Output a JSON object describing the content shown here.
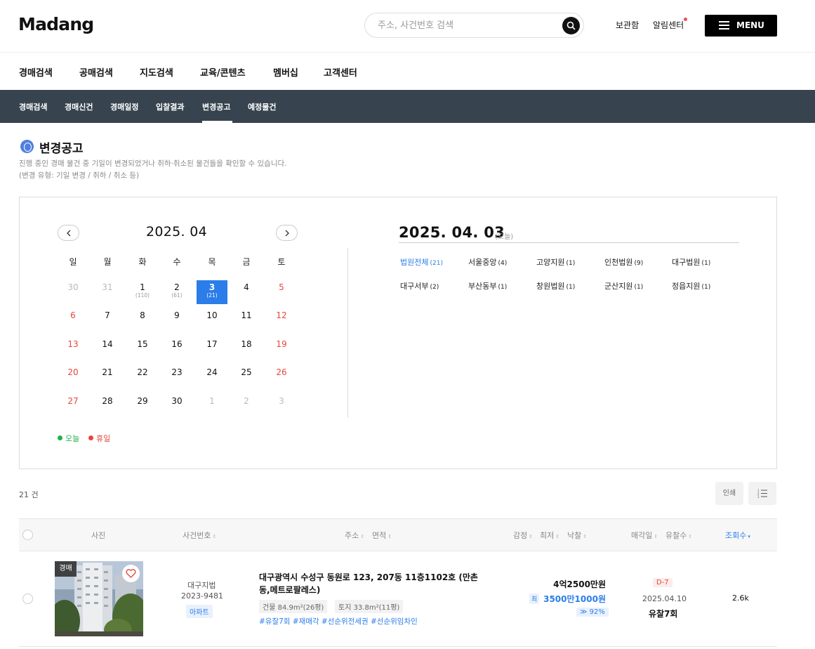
{
  "header": {
    "logo": "Madang",
    "search_placeholder": "주소, 사건번호 검색",
    "links": {
      "saved": "보관함",
      "alerts": "알림센터"
    },
    "menu_label": "MENU"
  },
  "main_nav": [
    "경매검색",
    "공매검색",
    "지도검색",
    "교육/콘텐츠",
    "멤버십",
    "고객센터"
  ],
  "sub_nav": {
    "items": [
      "경매검색",
      "경매신건",
      "경매일정",
      "입찰결과",
      "변경공고",
      "예정물건"
    ],
    "active": "변경공고"
  },
  "page": {
    "title": "변경공고",
    "desc_line1": "진행 중인 경매 물건 중 기일이 변경되었거나 취하·취소된 물건들을 확인할 수 있습니다.",
    "desc_line2": "(변경 유형: 기일 변경 / 취하 / 취소 등)"
  },
  "calendar": {
    "month_title": "2025. 04",
    "weekdays": [
      "일",
      "월",
      "화",
      "수",
      "목",
      "금",
      "토"
    ],
    "weeks": [
      [
        {
          "d": "30",
          "t": "gray"
        },
        {
          "d": "31",
          "t": "gray"
        },
        {
          "d": "1",
          "c": "(110)"
        },
        {
          "d": "2",
          "c": "(61)"
        },
        {
          "d": "3",
          "c": "(21)",
          "t": "sel"
        },
        {
          "d": "4"
        },
        {
          "d": "5",
          "t": "red"
        }
      ],
      [
        {
          "d": "6",
          "t": "red"
        },
        {
          "d": "7"
        },
        {
          "d": "8"
        },
        {
          "d": "9"
        },
        {
          "d": "10"
        },
        {
          "d": "11"
        },
        {
          "d": "12",
          "t": "red"
        }
      ],
      [
        {
          "d": "13",
          "t": "red"
        },
        {
          "d": "14"
        },
        {
          "d": "15"
        },
        {
          "d": "16"
        },
        {
          "d": "17"
        },
        {
          "d": "18"
        },
        {
          "d": "19",
          "t": "red"
        }
      ],
      [
        {
          "d": "20",
          "t": "red"
        },
        {
          "d": "21"
        },
        {
          "d": "22"
        },
        {
          "d": "23"
        },
        {
          "d": "24"
        },
        {
          "d": "25"
        },
        {
          "d": "26",
          "t": "red"
        }
      ],
      [
        {
          "d": "27",
          "t": "red"
        },
        {
          "d": "28"
        },
        {
          "d": "29"
        },
        {
          "d": "30"
        },
        {
          "d": "1",
          "t": "gray"
        },
        {
          "d": "2",
          "t": "gray"
        },
        {
          "d": "3",
          "t": "gray"
        }
      ]
    ],
    "legend_today": "오늘",
    "legend_holiday": "휴일",
    "colors": {
      "today": "#22b14c",
      "holiday": "#e5463c",
      "selected": "#2b7de9"
    }
  },
  "selected": {
    "date": "2025. 04. 03",
    "today_label": "(오늘)",
    "courts": [
      {
        "name": "법원전체",
        "count": "(21)",
        "active": true
      },
      {
        "name": "서울중앙",
        "count": "(4)"
      },
      {
        "name": "고양지원",
        "count": "(1)"
      },
      {
        "name": "인천법원",
        "count": "(9)"
      },
      {
        "name": "대구법원",
        "count": "(1)"
      },
      {
        "name": "대구서부",
        "count": "(2)"
      },
      {
        "name": "부산동부",
        "count": "(1)"
      },
      {
        "name": "창원법원",
        "count": "(1)"
      },
      {
        "name": "군산지원",
        "count": "(1)"
      },
      {
        "name": "정읍지원",
        "count": "(1)"
      }
    ]
  },
  "results": {
    "count": "21 건",
    "print": "인쇄",
    "columns": {
      "photo": "사진",
      "case_no": "사건번호",
      "address": "주소",
      "area": "면적",
      "appraise": "감정",
      "min": "최저",
      "winning": "낙찰",
      "sale_date": "매각일",
      "fail_count": "유찰수",
      "views": "조회수"
    },
    "rows": [
      {
        "badge": "경매",
        "court": "대구지법",
        "case_no": "2023-9481",
        "type": "아파트",
        "address": "대구광역시 수성구 동원로 123, 207동 11층1102호 (만촌동,메트로팔레스)",
        "building": "건물 84.9m²(26평)",
        "land": "토지 33.8m²(11평)",
        "tags": "#유찰7회 #재매각 #선순위전세권 #선순위임차인",
        "appraise": "4억2500만원",
        "min_label": "최",
        "min": "3500만1000원",
        "pct": "≫ 92%",
        "dday": "D-7",
        "sale_date": "2025.04.10",
        "fail": "유찰7회",
        "views": "2.6k"
      }
    ]
  }
}
